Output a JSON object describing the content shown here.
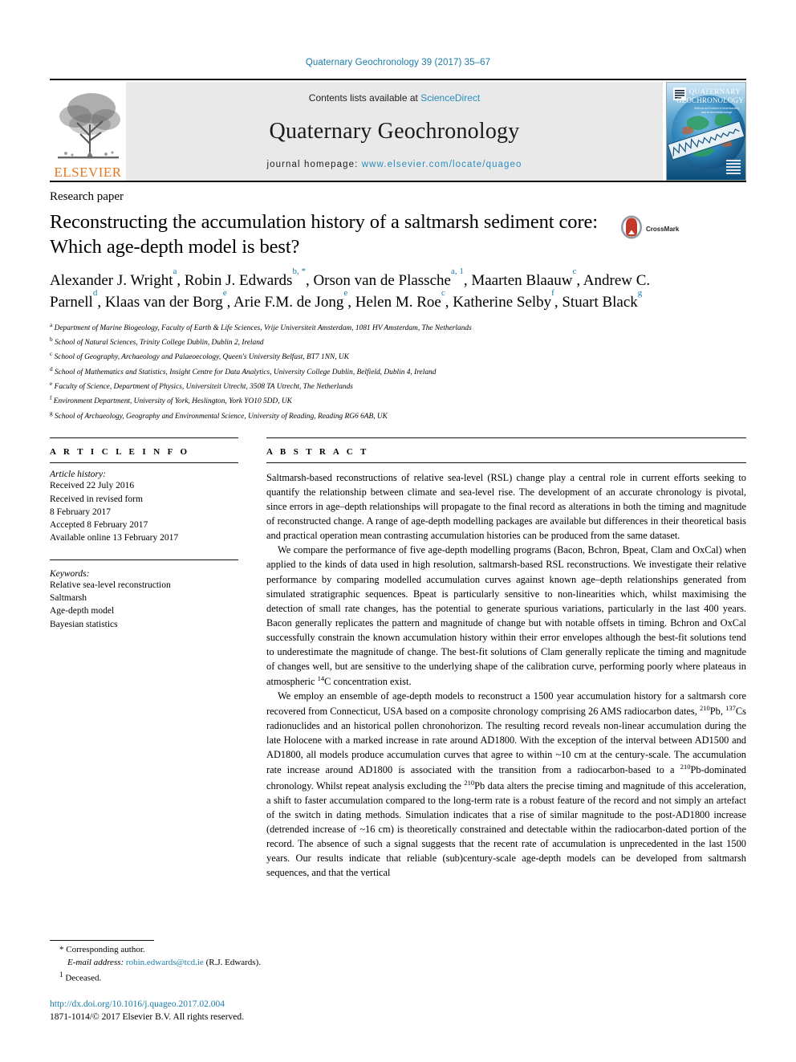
{
  "running_head": "Quaternary Geochronology 39 (2017) 35–67",
  "masthead": {
    "contents_prefix": "Contents lists available at ",
    "sciencedirect": "ScienceDirect",
    "journal_title": "Quaternary Geochronology",
    "homepage_prefix": "journal homepage: ",
    "homepage_url": "www.elsevier.com/locate/quageo",
    "publisher_name": "ELSEVIER",
    "cover_title_line1": "QUATERNARY",
    "cover_title_line2": "GEOCHRONOLOGY",
    "cover_subtitle": "Methods and Science of Understanding",
    "logo_icon": "elsevier-tree-icon",
    "cover_icon": "journal-cover-thumbnail"
  },
  "article": {
    "paper_type": "Research paper",
    "title": "Reconstructing the accumulation history of a saltmarsh sediment core: Which age-depth model is best?",
    "crossmark_label": "CrossMark",
    "crossmark_icon": "crossmark-logo-icon",
    "authors": [
      {
        "name": "Alexander J. Wright",
        "marks": "a",
        "sep": ", "
      },
      {
        "name": "Robin J. Edwards",
        "marks": "b, *",
        "sep": ", "
      },
      {
        "name": "Orson van de Plassche",
        "marks": "a, 1",
        "sep": ", "
      },
      {
        "name": "Maarten Blaauw",
        "marks": "c",
        "sep": ", "
      },
      {
        "name": "Andrew C. Parnell",
        "marks": "d",
        "sep": ", "
      },
      {
        "name": "Klaas van der Borg",
        "marks": "e",
        "sep": ", "
      },
      {
        "name": "Arie F.M. de Jong",
        "marks": "e",
        "sep": ", "
      },
      {
        "name": "Helen M. Roe",
        "marks": "c",
        "sep": ", "
      },
      {
        "name": "Katherine Selby",
        "marks": "f",
        "sep": ", "
      },
      {
        "name": "Stuart Black",
        "marks": "g",
        "sep": ""
      }
    ],
    "affiliations": [
      {
        "mark": "a",
        "text": "Department of Marine Biogeology, Faculty of Earth & Life Sciences, Vrije Universiteit Amsterdam, 1081 HV Amsterdam, The Netherlands"
      },
      {
        "mark": "b",
        "text": "School of Natural Sciences, Trinity College Dublin, Dublin 2, Ireland"
      },
      {
        "mark": "c",
        "text": "School of Geography, Archaeology and Palaeoecology, Queen's University Belfast, BT7 1NN, UK"
      },
      {
        "mark": "d",
        "text": "School of Mathematics and Statistics, Insight Centre for Data Analytics, University College Dublin, Belfield, Dublin 4, Ireland"
      },
      {
        "mark": "e",
        "text": "Faculty of Science, Department of Physics, Universiteit Utrecht, 3508 TA Utrecht, The Netherlands"
      },
      {
        "mark": "f",
        "text": "Environment Department, University of York, Heslington, York YO10 5DD, UK"
      },
      {
        "mark": "g",
        "text": "School of Archaeology, Geography and Environmental Science, University of Reading, Reading RG6 6AB, UK"
      }
    ]
  },
  "article_info": {
    "heading": "A R T I C L E   I N F O",
    "history_title": "Article history:",
    "history_lines": [
      "Received 22 July 2016",
      "Received in revised form",
      "8 February 2017",
      "Accepted 8 February 2017",
      "Available online 13 February 2017"
    ],
    "keywords_title": "Keywords:",
    "keywords": [
      "Relative sea-level reconstruction",
      "Saltmarsh",
      "Age-depth model",
      "Bayesian statistics"
    ]
  },
  "abstract": {
    "heading": "A B S T R A C T",
    "paragraphs": [
      "Saltmarsh-based reconstructions of relative sea-level (RSL) change play a central role in current efforts seeking to quantify the relationship between climate and sea-level rise. The development of an accurate chronology is pivotal, since errors in age–depth relationships will propagate to the final record as alterations in both the timing and magnitude of reconstructed change. A range of age-depth modelling packages are available but differences in their theoretical basis and practical operation mean contrasting accumulation histories can be produced from the same dataset.",
      "We compare the performance of five age-depth modelling programs (Bacon, Bchron, Bpeat, Clam and OxCal) when applied to the kinds of data used in high resolution, saltmarsh-based RSL reconstructions. We investigate their relative performance by comparing modelled accumulation curves against known age–depth relationships generated from simulated stratigraphic sequences. Bpeat is particularly sensitive to non-linearities which, whilst maximising the detection of small rate changes, has the potential to generate spurious variations, particularly in the last 400 years. Bacon generally replicates the pattern and magnitude of change but with notable offsets in timing. Bchron and OxCal successfully constrain the known accumulation history within their error envelopes although the best-fit solutions tend to underestimate the magnitude of change. The best-fit solutions of Clam generally replicate the timing and magnitude of changes well, but are sensitive to the underlying shape of the calibration curve, performing poorly where plateaus in atmospheric <sup>14</sup>C concentration exist.",
      "We employ an ensemble of age-depth models to reconstruct a 1500 year accumulation history for a saltmarsh core recovered from Connecticut, USA based on a composite chronology comprising 26 AMS radiocarbon dates, <sup>210</sup>Pb, <sup>137</sup>Cs radionuclides and an historical pollen chronohorizon. The resulting record reveals non-linear accumulation during the late Holocene with a marked increase in rate around AD1800. With the exception of the interval between AD1500 and AD1800, all models produce accumulation curves that agree to within ~10 cm at the century-scale. The accumulation rate increase around AD1800 is associated with the transition from a radiocarbon-based to a <sup>210</sup>Pb-dominated chronology. Whilst repeat analysis excluding the <sup>210</sup>Pb data alters the precise timing and magnitude of this acceleration, a shift to faster accumulation compared to the long-term rate is a robust feature of the record and not simply an artefact of the switch in dating methods. Simulation indicates that a rise of similar magnitude to the post-AD1800 increase (detrended increase of ~16 cm) is theoretically constrained and detectable within the radiocarbon-dated portion of the record. The absence of such a signal suggests that the recent rate of accumulation is unprecedented in the last 1500 years. Our results indicate that reliable (sub)century-scale age-depth models can be developed from saltmarsh sequences, and that the vertical"
    ]
  },
  "footnotes": {
    "corresponding_mark": "*",
    "corresponding_text": "Corresponding author.",
    "email_label": "E-mail address:",
    "email_address": "robin.edwards@tcd.ie",
    "email_suffix": "(R.J. Edwards).",
    "deceased_mark": "1",
    "deceased_text": "Deceased.",
    "doi": "http://dx.doi.org/10.1016/j.quageo.2017.02.004",
    "copyright": "1871-1014/© 2017 Elsevier B.V. All rights reserved."
  },
  "colors": {
    "link_blue": "#1a7ba8",
    "elsevier_orange": "#e87722",
    "masthead_grey": "#e9e9e9",
    "crossmark_red": "#c0392b"
  }
}
